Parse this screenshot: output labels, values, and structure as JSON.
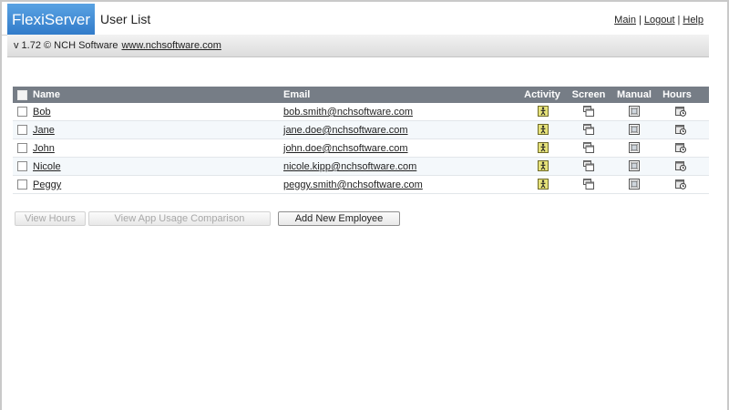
{
  "app": {
    "name": "FlexiServer"
  },
  "header": {
    "title": "User List",
    "links": [
      "Main",
      "Logout",
      "Help"
    ]
  },
  "version_bar": {
    "text": "v 1.72 © NCH Software",
    "link": "www.nchsoftware.com"
  },
  "table": {
    "columns": [
      "Name",
      "Email",
      "Activity",
      "Screen",
      "Manual",
      "Hours"
    ],
    "rows": [
      {
        "name": "Bob",
        "email": "bob.smith@nchsoftware.com"
      },
      {
        "name": "Jane",
        "email": "jane.doe@nchsoftware.com"
      },
      {
        "name": "John",
        "email": "john.doe@nchsoftware.com"
      },
      {
        "name": "Nicole",
        "email": "nicole.kipp@nchsoftware.com"
      },
      {
        "name": "Peggy",
        "email": "peggy.smith@nchsoftware.com"
      }
    ]
  },
  "buttons": {
    "view_hours": "View Hours",
    "view_app_usage": "View App Usage Comparison",
    "add_employee": "Add New Employee"
  },
  "icons": {
    "activity": "activity-person-icon",
    "screen": "screen-windows-icon",
    "manual": "manual-image-icon",
    "hours": "hours-clock-icon"
  },
  "colors": {
    "logo_blue": "#2f79c8",
    "table_header": "#767d86",
    "activity_icon": "#e6e27a"
  }
}
